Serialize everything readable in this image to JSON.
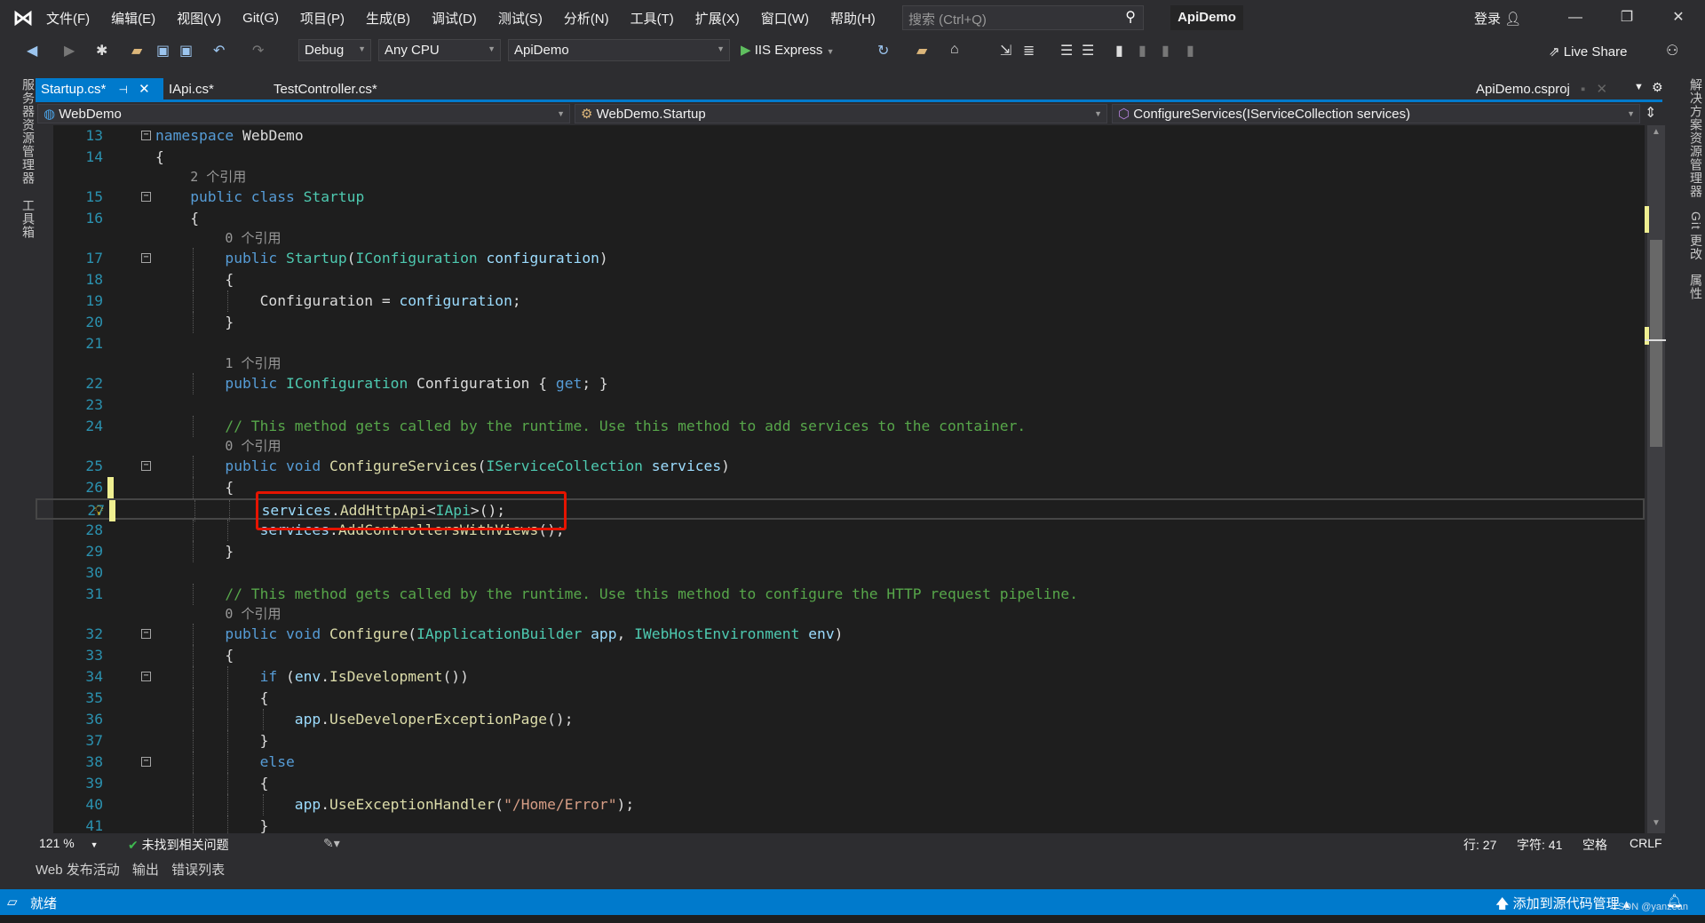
{
  "menu": {
    "items": [
      "文件(F)",
      "编辑(E)",
      "视图(V)",
      "Git(G)",
      "项目(P)",
      "生成(B)",
      "调试(D)",
      "测试(S)",
      "分析(N)",
      "工具(T)",
      "扩展(X)",
      "窗口(W)",
      "帮助(H)"
    ],
    "search_placeholder": "搜索 (Ctrl+Q)",
    "window_title": "ApiDemo",
    "login": "登录"
  },
  "toolbar": {
    "configuration": "Debug",
    "platform": "Any CPU",
    "startup_project": "ApiDemo",
    "run_target": "IIS Express",
    "live_share": "Live Share"
  },
  "left_strip": {
    "server_explorer": "服务器资源管理器",
    "toolbox": "工具箱"
  },
  "right_strip": {
    "solution_explorer": "解决方案资源管理器",
    "git_changes": "Git 更改",
    "properties": "属性"
  },
  "tabs": [
    {
      "label": "Startup.cs*",
      "active": true
    },
    {
      "label": "IApi.cs*",
      "active": false
    },
    {
      "label": "TestController.cs*",
      "active": false
    }
  ],
  "tab_right": "ApiDemo.csproj",
  "navbar": {
    "project": "WebDemo",
    "type": "WebDemo.Startup",
    "member": "ConfigureServices(IServiceCollection services)"
  },
  "code": {
    "current_line": 27,
    "lines": [
      {
        "n": 13,
        "i": 0,
        "fold": true,
        "tk": [
          [
            "namespace",
            "k"
          ],
          [
            " WebDemo",
            "p"
          ]
        ]
      },
      {
        "n": 14,
        "i": 0,
        "tk": [
          [
            "{",
            "p"
          ]
        ]
      },
      {
        "lens": "2 个引用",
        "i": 1
      },
      {
        "n": 15,
        "i": 1,
        "fold": true,
        "tk": [
          [
            "public class ",
            "k"
          ],
          [
            "Startup",
            "t"
          ]
        ]
      },
      {
        "n": 16,
        "i": 1,
        "tk": [
          [
            "{",
            "p"
          ]
        ]
      },
      {
        "lens": "0 个引用",
        "i": 2
      },
      {
        "n": 17,
        "i": 2,
        "fold": true,
        "tk": [
          [
            "public ",
            "k"
          ],
          [
            "Startup",
            "t"
          ],
          [
            "(",
            "p"
          ],
          [
            "IConfiguration",
            "t"
          ],
          [
            " configuration",
            "v"
          ],
          [
            ")",
            "p"
          ]
        ]
      },
      {
        "n": 18,
        "i": 2,
        "tk": [
          [
            "{",
            "p"
          ]
        ]
      },
      {
        "n": 19,
        "i": 3,
        "tk": [
          [
            "Configuration",
            "p"
          ],
          [
            " = ",
            "p"
          ],
          [
            "configuration",
            "v"
          ],
          [
            ";",
            "p"
          ]
        ]
      },
      {
        "n": 20,
        "i": 2,
        "tk": [
          [
            "}",
            "p"
          ]
        ]
      },
      {
        "n": 21,
        "i": 0,
        "tk": []
      },
      {
        "lens": "1 个引用",
        "i": 2
      },
      {
        "n": 22,
        "i": 2,
        "tk": [
          [
            "public ",
            "k"
          ],
          [
            "IConfiguration",
            "t"
          ],
          [
            " Configuration { ",
            "p"
          ],
          [
            "get",
            "k"
          ],
          [
            "; }",
            "p"
          ]
        ]
      },
      {
        "n": 23,
        "i": 0,
        "tk": []
      },
      {
        "n": 24,
        "i": 2,
        "tk": [
          [
            "// This method gets called by the runtime. Use this method to add services to the container.",
            "c"
          ]
        ]
      },
      {
        "lens": "0 个引用",
        "i": 2
      },
      {
        "n": 25,
        "i": 2,
        "fold": true,
        "tk": [
          [
            "public void ",
            "k"
          ],
          [
            "ConfigureServices",
            "m"
          ],
          [
            "(",
            "p"
          ],
          [
            "IServiceCollection",
            "t"
          ],
          [
            " services",
            "v"
          ],
          [
            ")",
            "p"
          ]
        ]
      },
      {
        "n": 26,
        "i": 2,
        "tk": [
          [
            "{",
            "p"
          ]
        ]
      },
      {
        "n": 27,
        "i": 3,
        "tk": [
          [
            "services",
            "v"
          ],
          [
            ".",
            "p"
          ],
          [
            "AddHttpApi",
            "m"
          ],
          [
            "<",
            "p"
          ],
          [
            "IApi",
            "t"
          ],
          [
            ">();",
            "p"
          ]
        ]
      },
      {
        "n": 28,
        "i": 3,
        "tk": [
          [
            "services",
            "v"
          ],
          [
            ".",
            "p"
          ],
          [
            "AddControllersWithViews",
            "m"
          ],
          [
            "();",
            "p"
          ]
        ]
      },
      {
        "n": 29,
        "i": 2,
        "tk": [
          [
            "}",
            "p"
          ]
        ]
      },
      {
        "n": 30,
        "i": 0,
        "tk": []
      },
      {
        "n": 31,
        "i": 2,
        "tk": [
          [
            "// This method gets called by the runtime. Use this method to configure the HTTP request pipeline.",
            "c"
          ]
        ]
      },
      {
        "lens": "0 个引用",
        "i": 2
      },
      {
        "n": 32,
        "i": 2,
        "fold": true,
        "tk": [
          [
            "public void ",
            "k"
          ],
          [
            "Configure",
            "m"
          ],
          [
            "(",
            "p"
          ],
          [
            "IApplicationBuilder",
            "t"
          ],
          [
            " app",
            "v"
          ],
          [
            ", ",
            "p"
          ],
          [
            "IWebHostEnvironment",
            "t"
          ],
          [
            " env",
            "v"
          ],
          [
            ")",
            "p"
          ]
        ]
      },
      {
        "n": 33,
        "i": 2,
        "tk": [
          [
            "{",
            "p"
          ]
        ]
      },
      {
        "n": 34,
        "i": 3,
        "fold": true,
        "tk": [
          [
            "if",
            "k"
          ],
          [
            " (",
            "p"
          ],
          [
            "env",
            "v"
          ],
          [
            ".",
            "p"
          ],
          [
            "IsDevelopment",
            "m"
          ],
          [
            "())",
            "p"
          ]
        ]
      },
      {
        "n": 35,
        "i": 3,
        "tk": [
          [
            "{",
            "p"
          ]
        ]
      },
      {
        "n": 36,
        "i": 4,
        "tk": [
          [
            "app",
            "v"
          ],
          [
            ".",
            "p"
          ],
          [
            "UseDeveloperExceptionPage",
            "m"
          ],
          [
            "();",
            "p"
          ]
        ]
      },
      {
        "n": 37,
        "i": 3,
        "tk": [
          [
            "}",
            "p"
          ]
        ]
      },
      {
        "n": 38,
        "i": 3,
        "fold": true,
        "tk": [
          [
            "else",
            "k"
          ]
        ]
      },
      {
        "n": 39,
        "i": 3,
        "tk": [
          [
            "{",
            "p"
          ]
        ]
      },
      {
        "n": 40,
        "i": 4,
        "tk": [
          [
            "app",
            "v"
          ],
          [
            ".",
            "p"
          ],
          [
            "UseExceptionHandler",
            "m"
          ],
          [
            "(",
            "p"
          ],
          [
            "\"/Home/Error\"",
            "s"
          ],
          [
            ");",
            "p"
          ]
        ]
      },
      {
        "n": 41,
        "i": 3,
        "tk": [
          [
            "}",
            "p"
          ]
        ]
      }
    ]
  },
  "editor_status": {
    "zoom": "121 %",
    "issues": "未找到相关问题",
    "line": "行: 27",
    "char": "字符: 41",
    "spacing": "空格",
    "eol": "CRLF"
  },
  "bottom_tabs": [
    "Web 发布活动",
    "输出",
    "错误列表"
  ],
  "statusbar": {
    "state": "就绪",
    "source_control": "添加到源代码管理",
    "watermark": "CSDN @yanzean"
  },
  "colors": {
    "accent": "#007acc",
    "highlight_box": "#e51400",
    "change_marker": "#efef91"
  }
}
